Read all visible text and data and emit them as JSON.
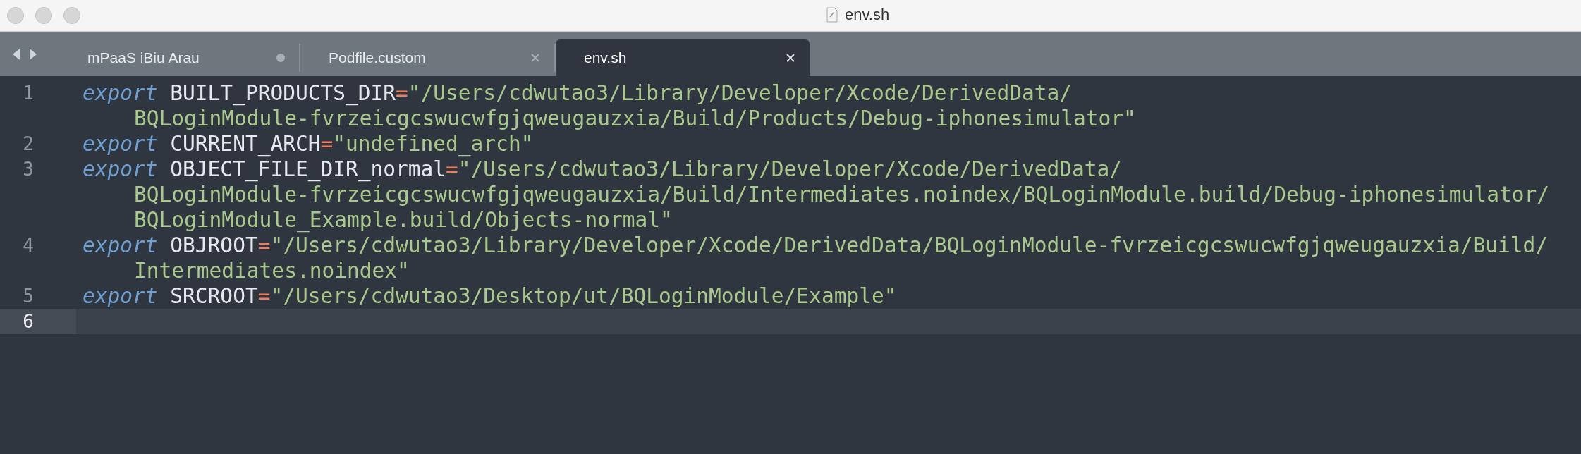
{
  "window": {
    "title": "env.sh"
  },
  "tabs": [
    {
      "label": "mPaaS iBiu Arau",
      "selected": false,
      "modified": true
    },
    {
      "label": "Podfile.custom",
      "selected": false,
      "modified": false
    },
    {
      "label": "env.sh",
      "selected": true,
      "modified": false
    }
  ],
  "editor": {
    "lines": [
      {
        "number": "1",
        "current": false,
        "keyword": "export",
        "variable": "BUILT_PRODUCTS_DIR",
        "operator": "=",
        "rows": [
          "\"/Users/cdwutao3/Library/Developer/Xcode/DerivedData/",
          "BQLoginModule-fvrzeicgcswucwfgjqweugauzxia/Build/Products/Debug-iphonesimulator\""
        ]
      },
      {
        "number": "2",
        "current": false,
        "keyword": "export",
        "variable": "CURRENT_ARCH",
        "operator": "=",
        "rows": [
          "\"undefined_arch\""
        ]
      },
      {
        "number": "3",
        "current": false,
        "keyword": "export",
        "variable": "OBJECT_FILE_DIR_normal",
        "operator": "=",
        "rows": [
          "\"/Users/cdwutao3/Library/Developer/Xcode/DerivedData/",
          "BQLoginModule-fvrzeicgcswucwfgjqweugauzxia/Build/Intermediates.noindex/BQLoginModule.build/Debug-iphonesimulator/",
          "BQLoginModule_Example.build/Objects-normal\""
        ]
      },
      {
        "number": "4",
        "current": false,
        "keyword": "export",
        "variable": "OBJROOT",
        "operator": "=",
        "rows": [
          "\"/Users/cdwutao3/Library/Developer/Xcode/DerivedData/BQLoginModule-fvrzeicgcswucwfgjqweugauzxia/Build/",
          "Intermediates.noindex\""
        ]
      },
      {
        "number": "5",
        "current": false,
        "keyword": "export",
        "variable": "SRCROOT",
        "operator": "=",
        "rows": [
          "\"/Users/cdwutao3/Desktop/ut/BQLoginModule/Example\""
        ]
      },
      {
        "number": "6",
        "current": true
      }
    ]
  }
}
